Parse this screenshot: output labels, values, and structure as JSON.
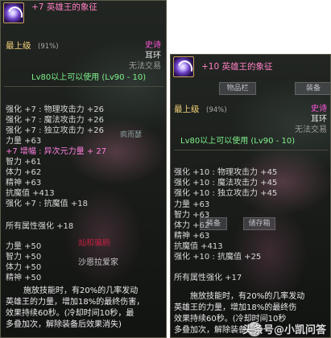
{
  "left": {
    "title": "+7 英雄王的象征",
    "grade": "最上级",
    "grade_pct": "(91%)",
    "rarity": "史诗",
    "slot": "耳环",
    "trade": "无法交易",
    "level_req": "Lv80以上可以使用 (Lv90 - 10)",
    "stats_enh": [
      {
        "label": "强化 +7 : 物理攻击力 +26"
      },
      {
        "label": "强化 +7 : 魔法攻击力 +26"
      },
      {
        "label": "强化 +7 : 独立攻击力 +26"
      },
      {
        "label": "力量 +63"
      }
    ],
    "amp_line": "+7 增幅 : 异次元力量 + 27",
    "base_stats": [
      "智力 +61",
      "体力 +62",
      "精神 +63",
      "抗魔值 +413"
    ],
    "magic_res_enh": "强化 +7 : 抗魔值 +18",
    "all_attr": "所有属性强化 +18",
    "bonus_stats": [
      "力量 +50",
      "智力 +50",
      "体力 +50",
      "精神 +50"
    ],
    "desc_lines": [
      "施放技能时，有20%的几率发动",
      "英雄王的力量，增加18%的最终伤害，",
      "效果持续60秒。(冷却时间10秒，最",
      "多叠加次，解除装备后效果消失)"
    ],
    "bg_labels": [
      "疯而瑟",
      "灿和骗刷",
      "沙恩拉爱家"
    ]
  },
  "right": {
    "title": "+10 英雄王的象征",
    "grade": "最上级",
    "grade_pct": "(94%)",
    "rarity": "史诗",
    "slot": "耳环",
    "trade": "无法交易",
    "level_req": "Lv80以上可以使用 (Lv90 - 10)",
    "tabs": [
      "物品栏",
      "装备"
    ],
    "stats_enh": [
      "强化 +10 : 物理攻击力 +45",
      "强化 +10 : 魔法攻击力 +45",
      "强化 +10 : 独立攻击力 +45"
    ],
    "base_stats": [
      "力量 +63",
      "智力 +63",
      "体力 +62",
      "精神 +63",
      "抗魔值 +413"
    ],
    "magic_res_enh": "强化 +10 : 抗魔值 +25",
    "all_attr": "所有属性强化 +17",
    "bottom_tabs": [
      "装备",
      "储存箱"
    ],
    "desc_lines": [
      "施放技能时，有20%的几率发动",
      "英雄王的力量，增加18%的最终伤",
      "效果持续60秒。(冷却时间10秒",
      "多叠加次，解除装备后效"
    ]
  },
  "watermark": "头条号@小凯问答"
}
